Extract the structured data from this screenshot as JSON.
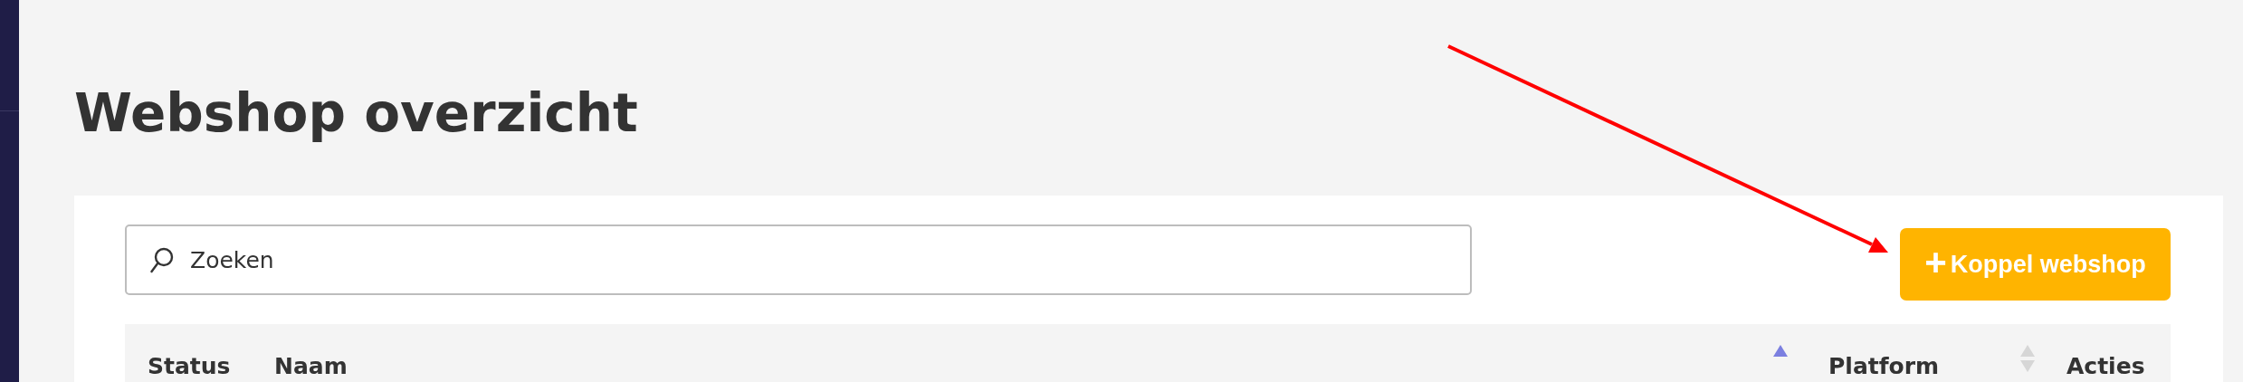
{
  "page": {
    "title": "Webshop overzicht"
  },
  "search": {
    "placeholder": "Zoeken"
  },
  "add_button": {
    "icon": "+",
    "label": "Koppel webshop"
  },
  "table": {
    "columns": [
      {
        "label": "Status"
      },
      {
        "label": "Naam",
        "sorted": true
      },
      {
        "label": "Platform",
        "sorted": false
      }
    ],
    "action_column": {
      "label": "Acties"
    }
  },
  "annotation": {
    "kind": "arrow"
  }
}
